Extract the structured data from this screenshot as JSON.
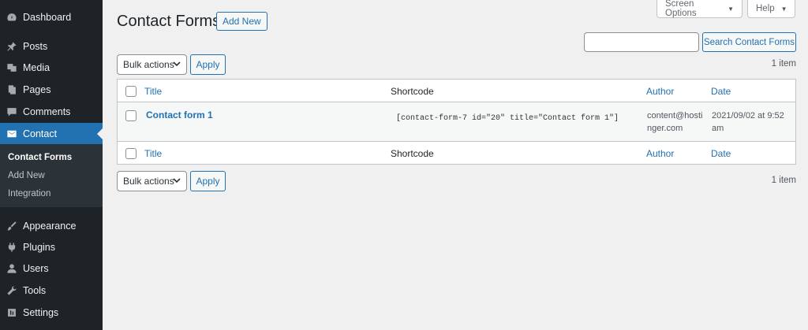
{
  "sidebar": {
    "items": [
      {
        "key": "dashboard",
        "label": "Dashboard",
        "icon": "dashboard-icon"
      },
      {
        "key": "posts",
        "label": "Posts",
        "icon": "pin-icon"
      },
      {
        "key": "media",
        "label": "Media",
        "icon": "media-icon"
      },
      {
        "key": "pages",
        "label": "Pages",
        "icon": "pages-icon"
      },
      {
        "key": "comments",
        "label": "Comments",
        "icon": "comment-icon"
      },
      {
        "key": "contact",
        "label": "Contact",
        "icon": "mail-icon"
      },
      {
        "key": "appearance",
        "label": "Appearance",
        "icon": "brush-icon"
      },
      {
        "key": "plugins",
        "label": "Plugins",
        "icon": "plug-icon"
      },
      {
        "key": "users",
        "label": "Users",
        "icon": "user-icon"
      },
      {
        "key": "tools",
        "label": "Tools",
        "icon": "wrench-icon"
      },
      {
        "key": "settings",
        "label": "Settings",
        "icon": "settings-icon"
      }
    ],
    "submenu": [
      {
        "label": "Contact Forms"
      },
      {
        "label": "Add New"
      },
      {
        "label": "Integration"
      }
    ],
    "active_color": "#2271b1"
  },
  "header": {
    "title": "Contact Forms",
    "add_new": "Add New",
    "screen_options": "Screen Options",
    "help": "Help"
  },
  "search": {
    "value": "",
    "button": "Search Contact Forms"
  },
  "bulk": {
    "top": {
      "label": "Bulk actions",
      "apply": "Apply",
      "count": "1 item"
    },
    "bottom": {
      "label": "Bulk actions",
      "apply": "Apply",
      "count": "1 item"
    }
  },
  "table": {
    "columns": {
      "title": "Title",
      "shortcode": "Shortcode",
      "author": "Author",
      "date": "Date"
    },
    "rows": [
      {
        "title": "Contact form 1",
        "shortcode": "[contact-form-7 id=\"20\" title=\"Contact form 1\"]",
        "author": "content@hostinger.com",
        "date": "2021/09/02 at 9:52 am"
      }
    ]
  }
}
